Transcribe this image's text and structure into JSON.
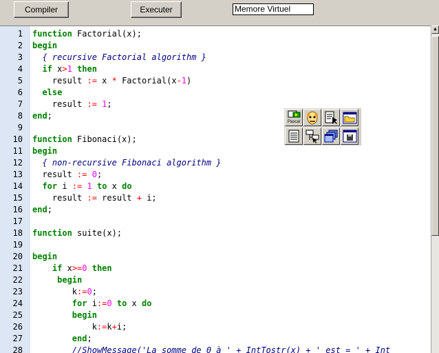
{
  "toolbar": {
    "compile_label": "Compiler",
    "execute_label": "Executer",
    "memory_value": "Memore Virtuel"
  },
  "palette": {
    "pascal_label": "Pascal",
    "tools": [
      "pascal-compile-icon",
      "robot-face-icon",
      "document-cursor-icon",
      "open-folder-icon",
      "list-document-icon",
      "tree-view-icon",
      "multi-window-icon",
      "save-disk-icon"
    ]
  },
  "editor": {
    "line_numbers": [
      "1",
      "2",
      "3",
      "4",
      "5",
      "6",
      "7",
      "8",
      "9",
      "10",
      "11",
      "12",
      "13",
      "14",
      "15",
      "16",
      "17",
      "18",
      "19",
      "20",
      "21",
      "22",
      "23",
      "24",
      "25",
      "26",
      "27",
      "28"
    ],
    "lines": [
      [
        {
          "t": "function",
          "c": "kw"
        },
        {
          "t": " Factorial(x);"
        }
      ],
      [
        {
          "t": "begin",
          "c": "kw"
        }
      ],
      [
        {
          "t": "  { recursive Factorial algorithm }",
          "c": "cm"
        }
      ],
      [
        {
          "t": "  "
        },
        {
          "t": "if",
          "c": "kw"
        },
        {
          "t": " x"
        },
        {
          "t": ">",
          "c": "op"
        },
        {
          "t": "1",
          "c": "num"
        },
        {
          "t": " "
        },
        {
          "t": "then",
          "c": "kw"
        }
      ],
      [
        {
          "t": "    result "
        },
        {
          "t": ":=",
          "c": "op"
        },
        {
          "t": " x "
        },
        {
          "t": "*",
          "c": "op"
        },
        {
          "t": " Factorial(x"
        },
        {
          "t": "-",
          "c": "op"
        },
        {
          "t": "1",
          "c": "num"
        },
        {
          "t": ")"
        }
      ],
      [
        {
          "t": "  "
        },
        {
          "t": "else",
          "c": "kw"
        }
      ],
      [
        {
          "t": "    result "
        },
        {
          "t": ":=",
          "c": "op"
        },
        {
          "t": " "
        },
        {
          "t": "1",
          "c": "num"
        },
        {
          "t": ";"
        }
      ],
      [
        {
          "t": "end",
          "c": "kw"
        },
        {
          "t": ";"
        }
      ],
      [
        {
          "t": ""
        }
      ],
      [
        {
          "t": "function",
          "c": "kw"
        },
        {
          "t": " Fibonaci(x);"
        }
      ],
      [
        {
          "t": "begin",
          "c": "kw"
        }
      ],
      [
        {
          "t": "  { non-recursive Fibonaci algorithm }",
          "c": "cm"
        }
      ],
      [
        {
          "t": "  result "
        },
        {
          "t": ":=",
          "c": "op"
        },
        {
          "t": " "
        },
        {
          "t": "0",
          "c": "num"
        },
        {
          "t": ";"
        }
      ],
      [
        {
          "t": "  "
        },
        {
          "t": "for",
          "c": "kw"
        },
        {
          "t": " i "
        },
        {
          "t": ":=",
          "c": "op"
        },
        {
          "t": " "
        },
        {
          "t": "1",
          "c": "num"
        },
        {
          "t": " "
        },
        {
          "t": "to",
          "c": "kw"
        },
        {
          "t": " x "
        },
        {
          "t": "do",
          "c": "kw"
        }
      ],
      [
        {
          "t": "    result "
        },
        {
          "t": ":=",
          "c": "op"
        },
        {
          "t": " result "
        },
        {
          "t": "+",
          "c": "op"
        },
        {
          "t": " i;"
        }
      ],
      [
        {
          "t": "end",
          "c": "kw"
        },
        {
          "t": ";"
        }
      ],
      [
        {
          "t": ""
        }
      ],
      [
        {
          "t": "function",
          "c": "kw"
        },
        {
          "t": " suite(x);"
        }
      ],
      [
        {
          "t": ""
        }
      ],
      [
        {
          "t": "begin",
          "c": "kw"
        }
      ],
      [
        {
          "t": "    "
        },
        {
          "t": "if",
          "c": "kw"
        },
        {
          "t": " x"
        },
        {
          "t": ">=",
          "c": "op"
        },
        {
          "t": "0",
          "c": "num"
        },
        {
          "t": " "
        },
        {
          "t": "then",
          "c": "kw"
        }
      ],
      [
        {
          "t": "     "
        },
        {
          "t": "begin",
          "c": "kw"
        }
      ],
      [
        {
          "t": "        k"
        },
        {
          "t": ":=",
          "c": "op"
        },
        {
          "t": "0",
          "c": "num"
        },
        {
          "t": ";"
        }
      ],
      [
        {
          "t": "        "
        },
        {
          "t": "for",
          "c": "kw"
        },
        {
          "t": " i"
        },
        {
          "t": ":=",
          "c": "op"
        },
        {
          "t": "0",
          "c": "num"
        },
        {
          "t": " "
        },
        {
          "t": "to",
          "c": "kw"
        },
        {
          "t": " x "
        },
        {
          "t": "do",
          "c": "kw"
        }
      ],
      [
        {
          "t": "        "
        },
        {
          "t": "begin",
          "c": "kw"
        }
      ],
      [
        {
          "t": "            k"
        },
        {
          "t": ":=",
          "c": "op"
        },
        {
          "t": "k"
        },
        {
          "t": "+",
          "c": "op"
        },
        {
          "t": "i;"
        }
      ],
      [
        {
          "t": "        "
        },
        {
          "t": "end",
          "c": "kw"
        },
        {
          "t": ";"
        }
      ],
      [
        {
          "t": "        //ShowMessage('La somme de 0 à ' + IntTostr(x) + ' est = ' + Int",
          "c": "cm"
        }
      ]
    ]
  }
}
